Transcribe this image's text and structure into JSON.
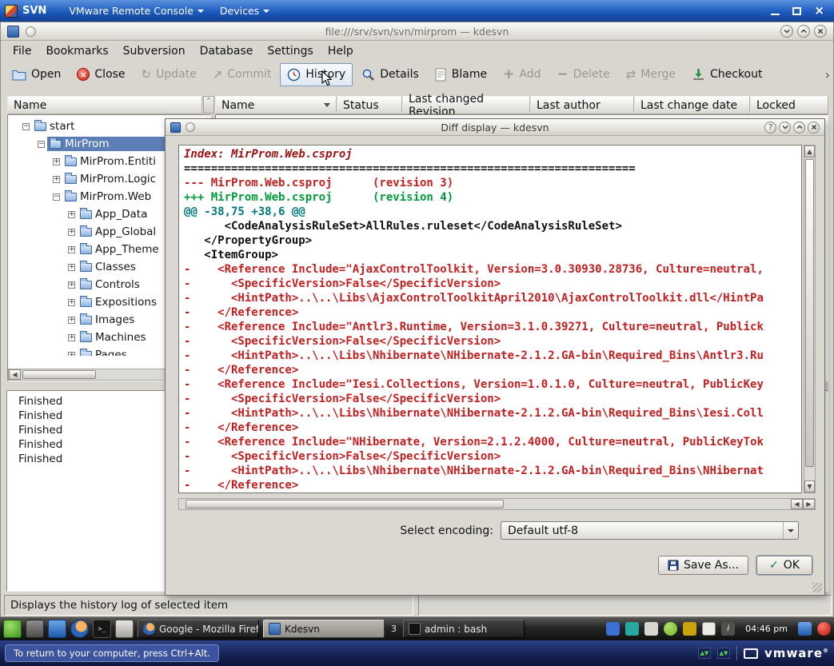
{
  "vmware": {
    "window_title": "SVN",
    "menus": [
      {
        "label": "VMware Remote Console"
      },
      {
        "label": "Devices"
      }
    ],
    "bottom_text": "To return to your computer, press Ctrl+Alt.",
    "brand": "vmware",
    "brand_reg": "®"
  },
  "app": {
    "title": "file:///srv/svn/svn/mirprom — kdesvn",
    "menu": [
      "File",
      "Bookmarks",
      "Subversion",
      "Database",
      "Settings",
      "Help"
    ],
    "toolbar": [
      {
        "label": "Open",
        "enabled": true
      },
      {
        "label": "Close",
        "enabled": true
      },
      {
        "label": "Update",
        "enabled": false
      },
      {
        "label": "Commit",
        "enabled": false
      },
      {
        "label": "History",
        "enabled": true,
        "hovered": true
      },
      {
        "label": "Details",
        "enabled": true
      },
      {
        "label": "Blame",
        "enabled": true
      },
      {
        "label": "Add",
        "enabled": false
      },
      {
        "label": "Delete",
        "enabled": false
      },
      {
        "label": "Merge",
        "enabled": false
      },
      {
        "label": "Checkout",
        "enabled": true
      }
    ],
    "tree_header": "Name",
    "tree": [
      {
        "label": "start",
        "depth": 0,
        "expander": "-",
        "selected": false
      },
      {
        "label": "MirProm",
        "depth": 1,
        "expander": "-",
        "selected": true
      },
      {
        "label": "MirProm.Entiti",
        "depth": 2,
        "expander": "+",
        "selected": false
      },
      {
        "label": "MirProm.Logic",
        "depth": 2,
        "expander": "+",
        "selected": false
      },
      {
        "label": "MirProm.Web",
        "depth": 2,
        "expander": "-",
        "selected": false
      },
      {
        "label": "App_Data",
        "depth": 3,
        "expander": "+",
        "selected": false
      },
      {
        "label": "App_Global",
        "depth": 3,
        "expander": "+",
        "selected": false
      },
      {
        "label": "App_Theme",
        "depth": 3,
        "expander": "+",
        "selected": false
      },
      {
        "label": "Classes",
        "depth": 3,
        "expander": "+",
        "selected": false
      },
      {
        "label": "Controls",
        "depth": 3,
        "expander": "+",
        "selected": false
      },
      {
        "label": "Expositions",
        "depth": 3,
        "expander": "+",
        "selected": false
      },
      {
        "label": "Images",
        "depth": 3,
        "expander": "+",
        "selected": false
      },
      {
        "label": "Machines",
        "depth": 3,
        "expander": "+",
        "selected": false
      },
      {
        "label": "Pages",
        "depth": 3,
        "expander": "+",
        "selected": false
      }
    ],
    "columns": [
      "Name",
      "Status",
      "Last changed Revision",
      "Last author",
      "Last change date",
      "Locked"
    ],
    "log": [
      "Finished",
      "Finished",
      "Finished",
      "Finished",
      "Finished"
    ],
    "status_text": "Displays the history log of selected item"
  },
  "dialog": {
    "title": "Diff display — kdesvn",
    "encoding_label": "Select encoding:",
    "encoding_value": "Default utf-8",
    "buttons": {
      "save_as": "Save As...",
      "ok": "OK"
    },
    "diff": [
      {
        "type": "index",
        "text": "Index: MirProm.Web.csproj"
      },
      {
        "type": "separator",
        "text": "==================================================================="
      },
      {
        "type": "removed-file",
        "text": "--- MirProm.Web.csproj      (revision 3)"
      },
      {
        "type": "added-file",
        "text": "+++ MirProm.Web.csproj      (revision 4)"
      },
      {
        "type": "hunk",
        "text": "@@ -38,75 +38,6 @@"
      },
      {
        "type": "context",
        "text": "      <CodeAnalysisRuleSet>AllRules.ruleset</CodeAnalysisRuleSet>"
      },
      {
        "type": "context",
        "text": "   </PropertyGroup>"
      },
      {
        "type": "context",
        "text": "   <ItemGroup>"
      },
      {
        "type": "removed",
        "text": "-    <Reference Include=\"AjaxControlToolkit, Version=3.0.30930.28736, Culture=neutral,"
      },
      {
        "type": "removed",
        "text": "-      <SpecificVersion>False</SpecificVersion>"
      },
      {
        "type": "removed",
        "text": "-      <HintPath>..\\..\\Libs\\AjaxControlToolkitApril2010\\AjaxControlToolkit.dll</HintPa"
      },
      {
        "type": "removed",
        "text": "-    </Reference>"
      },
      {
        "type": "removed",
        "text": "-    <Reference Include=\"Antlr3.Runtime, Version=3.1.0.39271, Culture=neutral, Publick"
      },
      {
        "type": "removed",
        "text": "-      <SpecificVersion>False</SpecificVersion>"
      },
      {
        "type": "removed",
        "text": "-      <HintPath>..\\..\\Libs\\Nhibernate\\NHibernate-2.1.2.GA-bin\\Required_Bins\\Antlr3.Ru"
      },
      {
        "type": "removed",
        "text": "-    </Reference>"
      },
      {
        "type": "removed",
        "text": "-    <Reference Include=\"Iesi.Collections, Version=1.0.1.0, Culture=neutral, PublicKey"
      },
      {
        "type": "removed",
        "text": "-      <SpecificVersion>False</SpecificVersion>"
      },
      {
        "type": "removed",
        "text": "-      <HintPath>..\\..\\Libs\\Nhibernate\\NHibernate-2.1.2.GA-bin\\Required_Bins\\Iesi.Coll"
      },
      {
        "type": "removed",
        "text": "-    </Reference>"
      },
      {
        "type": "removed",
        "text": "-    <Reference Include=\"NHibernate, Version=2.1.2.4000, Culture=neutral, PublicKeyTok"
      },
      {
        "type": "removed",
        "text": "-      <SpecificVersion>False</SpecificVersion>"
      },
      {
        "type": "removed",
        "text": "-      <HintPath>..\\..\\Libs\\Nhibernate\\NHibernate-2.1.2.GA-bin\\Required_Bins\\NHibernat"
      },
      {
        "type": "removed",
        "text": "-    </Reference>"
      }
    ]
  },
  "taskbar": {
    "tasks": [
      {
        "label": "Google - Mozilla Firef...",
        "icon": "firefox-icon",
        "active": false
      },
      {
        "label": "Kdesvn",
        "icon": "kdesvn-icon",
        "active": true
      },
      {
        "label": "admin : bash",
        "icon": "konsole-icon",
        "active": false
      }
    ],
    "pager": "3",
    "clock": "04:46 pm",
    "launcher_icons": [
      "kmenu-icon",
      "show-desktop-icon",
      "web-browser-icon",
      "firefox-icon",
      "konsole-icon",
      "keyboard-icon"
    ],
    "tray_icons": [
      "wallet-icon",
      "tea-icon",
      "tablet-icon",
      "suse-icon",
      "volume-icon",
      "klipper-icon",
      "info-icon",
      "display-icon",
      "shutdown-icon"
    ]
  },
  "colors": {
    "diff_removed": "#c22020",
    "diff_added": "#009a3c",
    "diff_hunk": "#00777c",
    "diff_index": "#9c1111",
    "tree_selection": "#5a7eb5",
    "vmware_titlebar": "#1d5bbf"
  }
}
